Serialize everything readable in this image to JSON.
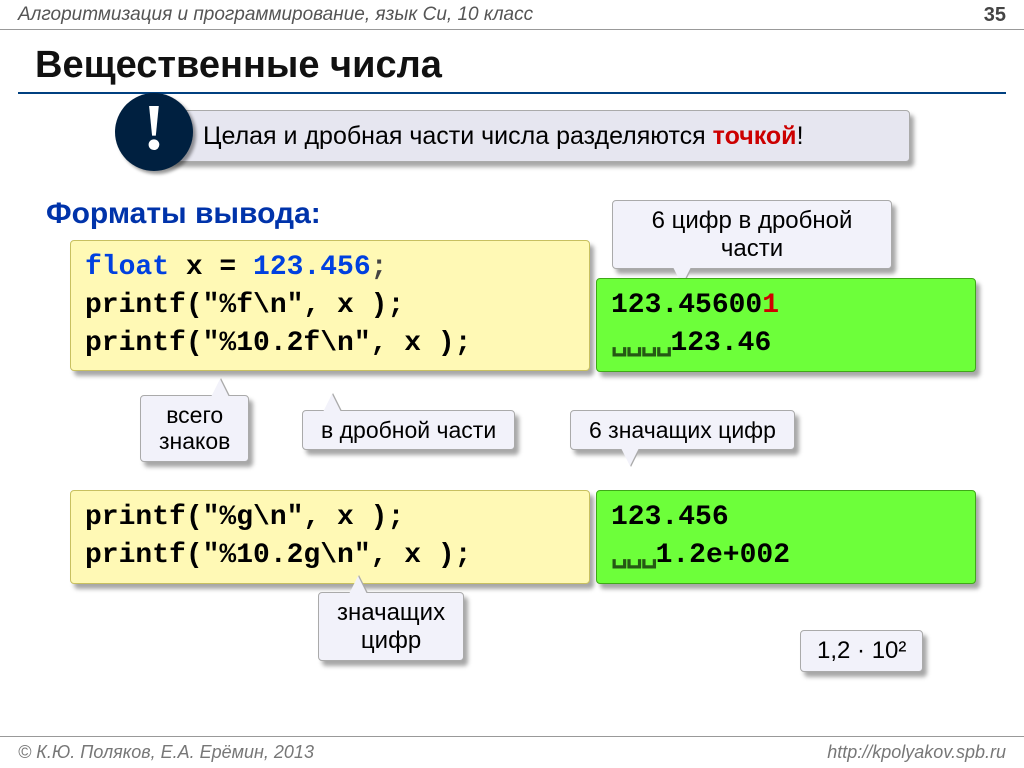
{
  "header": {
    "course": "Алгоритмизация и программирование, язык Си, 10 класс",
    "page": "35"
  },
  "title": "Вещественные числа",
  "note": {
    "bang": "!",
    "text_a": "Целая и дробная части числа разделяются ",
    "accent": "точкой",
    "tail": "!"
  },
  "subhead": "Форматы вывода:",
  "code1": {
    "kw": "float",
    "decl_rest": " x = ",
    "val": "123.456",
    "semi": ";",
    "l2": "printf(\"%f\\n\", x );",
    "l3": "printf(\"%10.2f\\n\", x );"
  },
  "out1": {
    "l1a": "123.45600",
    "l1b": "1",
    "pad": "␣␣␣␣",
    "l2": "123.46"
  },
  "bubble_top": "6 цифр в дробной\nчасти",
  "bubble_mid": {
    "b1": "всего\nзнаков",
    "b2": "в дробной части",
    "b3": "6 значащих цифр"
  },
  "code2": {
    "l1": "printf(\"%g\\n\", x );",
    "l2": "printf(\"%10.2g\\n\", x );"
  },
  "out2": {
    "l1": "123.456",
    "pad": "␣␣␣",
    "l2": "1.2e+002"
  },
  "bubble_bottom": "значащих\nцифр",
  "mini": "1,2 · 10²",
  "footer": {
    "left": "© К.Ю. Поляков, Е.А. Ерёмин, 2013",
    "right": "http://kpolyakov.spb.ru"
  }
}
